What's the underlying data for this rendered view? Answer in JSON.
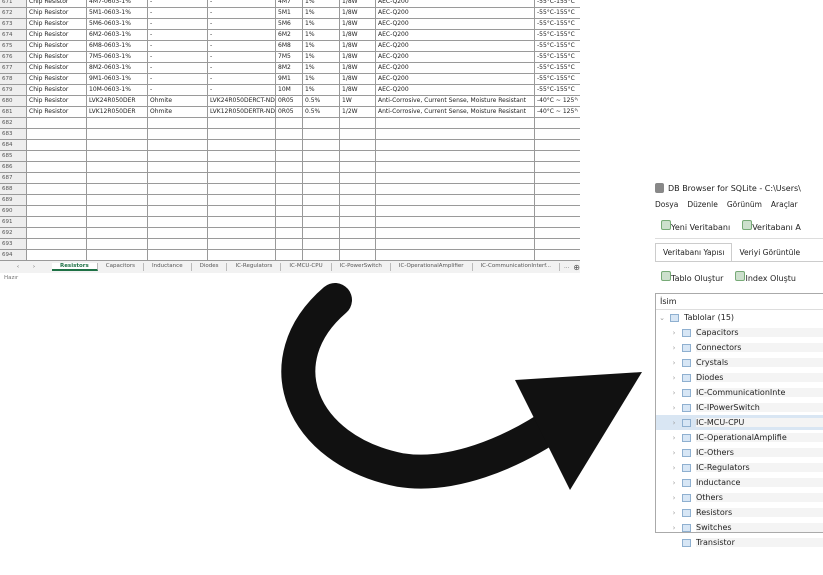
{
  "spreadsheet": {
    "rows": [
      {
        "n": "671",
        "cells": [
          "Chip Resistor",
          "4M7-0603-1%",
          "-",
          "-",
          "4M7",
          "1%",
          "1/8W",
          "AEC-Q200",
          "-55°C-155°C"
        ]
      },
      {
        "n": "672",
        "cells": [
          "Chip Resistor",
          "5M1-0603-1%",
          "-",
          "-",
          "5M1",
          "1%",
          "1/8W",
          "AEC-Q200",
          "-55°C-155°C"
        ]
      },
      {
        "n": "673",
        "cells": [
          "Chip Resistor",
          "5M6-0603-1%",
          "-",
          "-",
          "5M6",
          "1%",
          "1/8W",
          "AEC-Q200",
          "-55°C-155°C"
        ]
      },
      {
        "n": "674",
        "cells": [
          "Chip Resistor",
          "6M2-0603-1%",
          "-",
          "-",
          "6M2",
          "1%",
          "1/8W",
          "AEC-Q200",
          "-55°C-155°C"
        ]
      },
      {
        "n": "675",
        "cells": [
          "Chip Resistor",
          "6M8-0603-1%",
          "-",
          "-",
          "6M8",
          "1%",
          "1/8W",
          "AEC-Q200",
          "-55°C-155°C"
        ]
      },
      {
        "n": "676",
        "cells": [
          "Chip Resistor",
          "7M5-0603-1%",
          "-",
          "-",
          "7M5",
          "1%",
          "1/8W",
          "AEC-Q200",
          "-55°C-155°C"
        ]
      },
      {
        "n": "677",
        "cells": [
          "Chip Resistor",
          "8M2-0603-1%",
          "-",
          "-",
          "8M2",
          "1%",
          "1/8W",
          "AEC-Q200",
          "-55°C-155°C"
        ]
      },
      {
        "n": "678",
        "cells": [
          "Chip Resistor",
          "9M1-0603-1%",
          "-",
          "-",
          "9M1",
          "1%",
          "1/8W",
          "AEC-Q200",
          "-55°C-155°C"
        ]
      },
      {
        "n": "679",
        "cells": [
          "Chip Resistor",
          "10M-0603-1%",
          "-",
          "-",
          "10M",
          "1%",
          "1/8W",
          "AEC-Q200",
          "-55°C-155°C"
        ]
      },
      {
        "n": "680",
        "cells": [
          "Chip Resistor",
          "LVK24R050DER",
          "Ohmite",
          "LVK24R050DERCT-ND",
          "0R05",
          "0.5%",
          "1W",
          "Anti-Corrosive, Current Sense, Moisture Resistant",
          "-40°C ~ 125°C"
        ]
      },
      {
        "n": "681",
        "cells": [
          "Chip Resistor",
          "LVK12R050DER",
          "Ohmite",
          "LVK12R050DERTR-ND",
          "0R05",
          "0.5%",
          "1/2W",
          "Anti-Corrosive, Current Sense, Moisture Resistant",
          "-40°C ~ 125°C"
        ]
      },
      {
        "n": "682",
        "cells": [
          "",
          "",
          "",
          "",
          "",
          "",
          "",
          "",
          ""
        ]
      },
      {
        "n": "683",
        "cells": [
          "",
          "",
          "",
          "",
          "",
          "",
          "",
          "",
          ""
        ]
      },
      {
        "n": "684",
        "cells": [
          "",
          "",
          "",
          "",
          "",
          "",
          "",
          "",
          ""
        ]
      },
      {
        "n": "685",
        "cells": [
          "",
          "",
          "",
          "",
          "",
          "",
          "",
          "",
          ""
        ]
      },
      {
        "n": "686",
        "cells": [
          "",
          "",
          "",
          "",
          "",
          "",
          "",
          "",
          ""
        ]
      },
      {
        "n": "687",
        "cells": [
          "",
          "",
          "",
          "",
          "",
          "",
          "",
          "",
          ""
        ]
      },
      {
        "n": "688",
        "cells": [
          "",
          "",
          "",
          "",
          "",
          "",
          "",
          "",
          ""
        ]
      },
      {
        "n": "689",
        "cells": [
          "",
          "",
          "",
          "",
          "",
          "",
          "",
          "",
          ""
        ]
      },
      {
        "n": "690",
        "cells": [
          "",
          "",
          "",
          "",
          "",
          "",
          "",
          "",
          ""
        ]
      },
      {
        "n": "691",
        "cells": [
          "",
          "",
          "",
          "",
          "",
          "",
          "",
          "",
          ""
        ]
      },
      {
        "n": "692",
        "cells": [
          "",
          "",
          "",
          "",
          "",
          "",
          "",
          "",
          ""
        ]
      },
      {
        "n": "693",
        "cells": [
          "",
          "",
          "",
          "",
          "",
          "",
          "",
          "",
          ""
        ]
      },
      {
        "n": "694",
        "cells": [
          "",
          "",
          "",
          "",
          "",
          "",
          "",
          "",
          ""
        ]
      }
    ],
    "sheet_tabs": [
      "Resistors",
      "Capacitors",
      "Inductance",
      "Diodes",
      "IC-Regulators",
      "IC-MCU-CPU",
      "IC-PowerSwitch",
      "IC-OperationalAmplifier",
      "IC-CommunicationInterf..."
    ],
    "active_tab": "Resistors",
    "more": "...",
    "add_sheet": "⊕",
    "status": "Hazır"
  },
  "db_browser": {
    "title": "DB Browser for SQLite - C:\\Users\\",
    "menu": [
      "Dosya",
      "Düzenle",
      "Görünüm",
      "Araçlar"
    ],
    "toolbar": [
      "Yeni Veritabanı",
      "Veritabanı A"
    ],
    "tabs": [
      "Veritabanı Yapısı",
      "Veriyi Görüntüle"
    ],
    "tool2": [
      "Tablo Oluştur",
      "Index Oluştu"
    ],
    "tree_header": "İsim",
    "group": "Tablolar (15)",
    "tables": [
      "Capacitors",
      "Connectors",
      "Crystals",
      "Diodes",
      "IC-CommunicationInte",
      "IC-IPowerSwitch",
      "IC-MCU-CPU",
      "IC-OperationalAmplifie",
      "IC-Others",
      "IC-Regulators",
      "Inductance",
      "Others",
      "Resistors",
      "Switches",
      "Transistor"
    ],
    "selected": "IC-MCU-CPU"
  }
}
